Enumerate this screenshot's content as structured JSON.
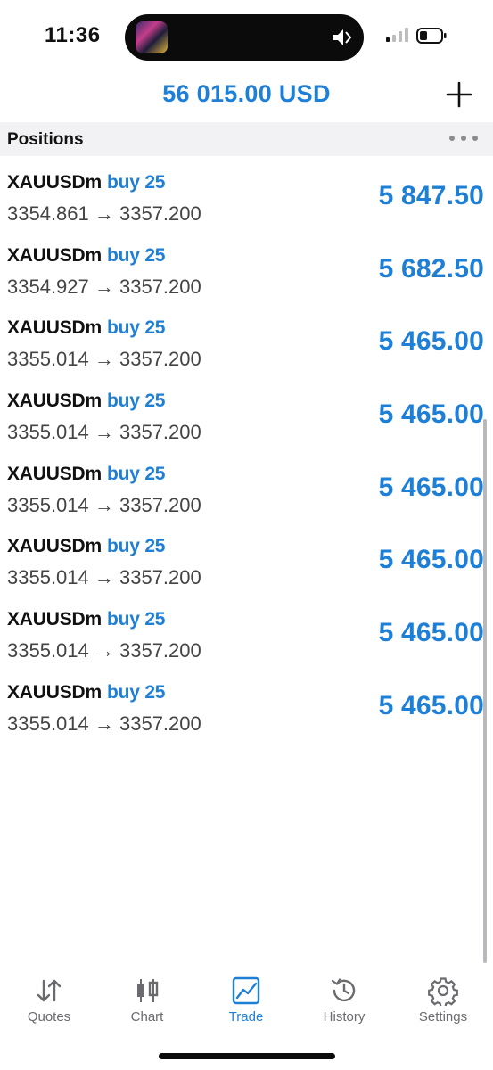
{
  "status_bar": {
    "time": "11:36"
  },
  "header": {
    "balance": "56 015.00 USD"
  },
  "section": {
    "title": "Positions"
  },
  "positions": [
    {
      "symbol": "XAUUSDm",
      "side": "buy 25",
      "prices": "3354.861 → 3357.200",
      "profit": "5 847.50"
    },
    {
      "symbol": "XAUUSDm",
      "side": "buy 25",
      "prices": "3354.927 → 3357.200",
      "profit": "5 682.50"
    },
    {
      "symbol": "XAUUSDm",
      "side": "buy 25",
      "prices": "3355.014 → 3357.200",
      "profit": "5 465.00"
    },
    {
      "symbol": "XAUUSDm",
      "side": "buy 25",
      "prices": "3355.014 → 3357.200",
      "profit": "5 465.00"
    },
    {
      "symbol": "XAUUSDm",
      "side": "buy 25",
      "prices": "3355.014 → 3357.200",
      "profit": "5 465.00"
    },
    {
      "symbol": "XAUUSDm",
      "side": "buy 25",
      "prices": "3355.014 → 3357.200",
      "profit": "5 465.00"
    },
    {
      "symbol": "XAUUSDm",
      "side": "buy 25",
      "prices": "3355.014 → 3357.200",
      "profit": "5 465.00"
    },
    {
      "symbol": "XAUUSDm",
      "side": "buy 25",
      "prices": "3355.014 → 3357.200",
      "profit": "5 465.00"
    }
  ],
  "tabs": [
    {
      "label": "Quotes",
      "icon": "quotes-arrows-icon",
      "active": false
    },
    {
      "label": "Chart",
      "icon": "candlestick-icon",
      "active": false
    },
    {
      "label": "Trade",
      "icon": "trade-chart-icon",
      "active": true
    },
    {
      "label": "History",
      "icon": "history-clock-icon",
      "active": false
    },
    {
      "label": "Settings",
      "icon": "gear-icon",
      "active": false
    }
  ],
  "colors": {
    "accent": "#1e7fd6",
    "label_gray": "#6a6a6f",
    "section_bg": "#f2f2f4"
  }
}
